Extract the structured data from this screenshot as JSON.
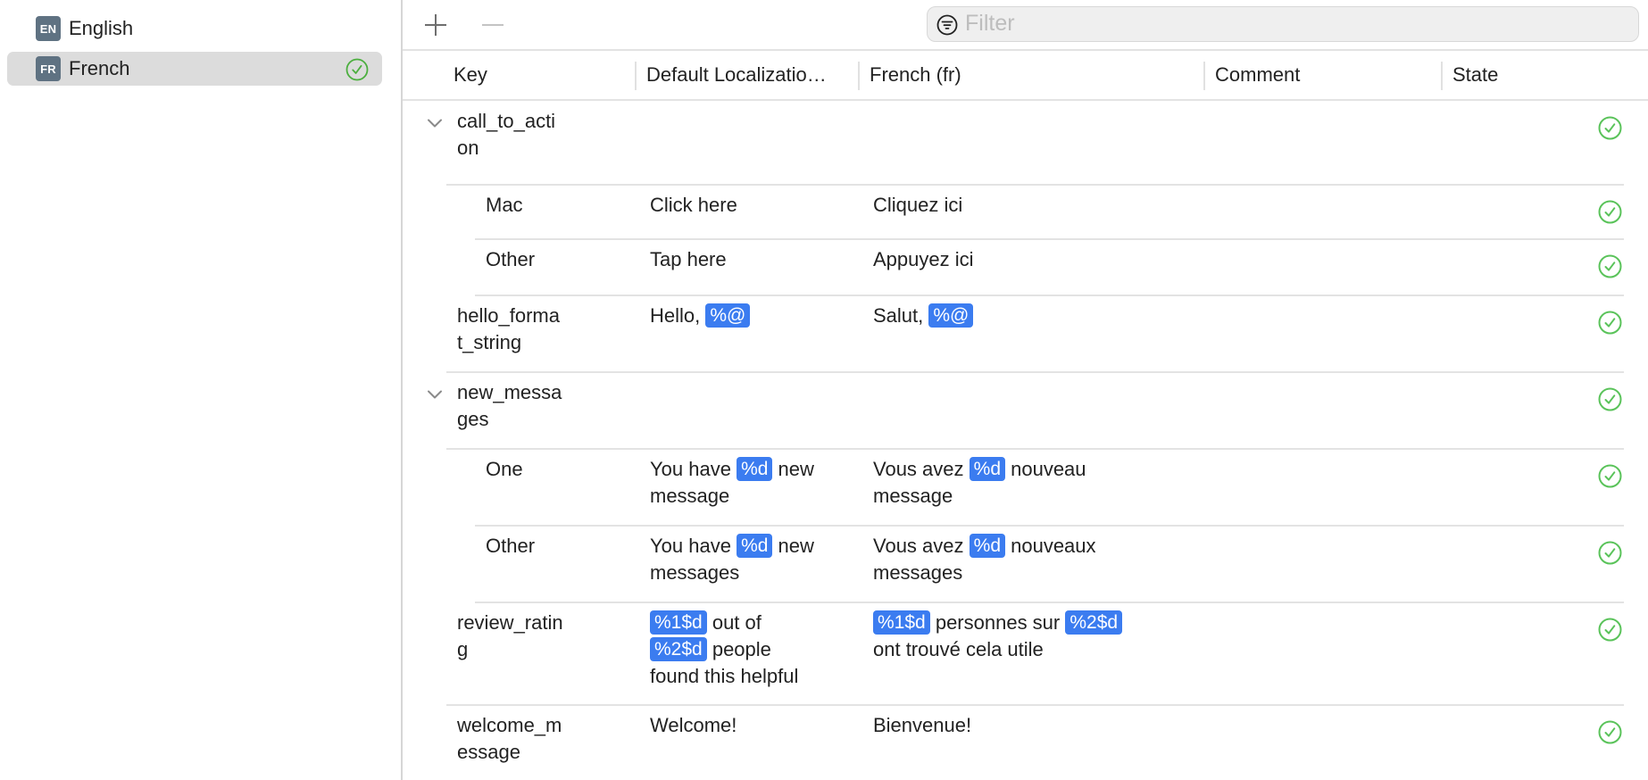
{
  "sidebar": {
    "languages": [
      {
        "code": "EN",
        "label": "English",
        "selected": false,
        "complete": false
      },
      {
        "code": "FR",
        "label": "French",
        "selected": true,
        "complete": true
      }
    ]
  },
  "toolbar": {
    "add_icon": "plus-icon",
    "remove_icon": "minus-icon",
    "filter_placeholder": "Filter",
    "filter_value": "",
    "filter_icon": "filter-circle-icon"
  },
  "columns": [
    "Key",
    "Default Localizatio…",
    "French (fr)",
    "Comment",
    "State"
  ],
  "rows": [
    {
      "key": [
        "call_to_acti",
        "on"
      ],
      "level": 0,
      "expandable": true,
      "expanded": true,
      "default": [],
      "french": [],
      "comment": "",
      "state": "translated"
    },
    {
      "key": [
        "Mac"
      ],
      "level": 1,
      "default": [
        [
          {
            "t": "Click here"
          }
        ]
      ],
      "french": [
        [
          {
            "t": "Cliquez ici"
          }
        ]
      ],
      "comment": "",
      "state": "translated"
    },
    {
      "key": [
        "Other"
      ],
      "level": 1,
      "default": [
        [
          {
            "t": "Tap here"
          }
        ]
      ],
      "french": [
        [
          {
            "t": "Appuyez ici"
          }
        ]
      ],
      "comment": "",
      "state": "translated"
    },
    {
      "key": [
        "hello_forma",
        "t_string"
      ],
      "level": 0,
      "default": [
        [
          {
            "t": "Hello, "
          },
          {
            "tok": "%@"
          }
        ]
      ],
      "french": [
        [
          {
            "t": "Salut, "
          },
          {
            "tok": "%@"
          }
        ]
      ],
      "comment": "",
      "state": "translated"
    },
    {
      "key": [
        "new_messa",
        "ges"
      ],
      "level": 0,
      "expandable": true,
      "expanded": true,
      "default": [],
      "french": [],
      "comment": "",
      "state": "translated"
    },
    {
      "key": [
        "One"
      ],
      "level": 1,
      "default": [
        [
          {
            "t": "You have "
          },
          {
            "tok": "%d"
          },
          {
            "t": " new"
          }
        ],
        [
          {
            "t": "message"
          }
        ]
      ],
      "french": [
        [
          {
            "t": "Vous avez "
          },
          {
            "tok": "%d"
          },
          {
            "t": " nouveau"
          }
        ],
        [
          {
            "t": "message"
          }
        ]
      ],
      "comment": "",
      "state": "translated"
    },
    {
      "key": [
        "Other"
      ],
      "level": 1,
      "default": [
        [
          {
            "t": "You have "
          },
          {
            "tok": "%d"
          },
          {
            "t": " new"
          }
        ],
        [
          {
            "t": "messages"
          }
        ]
      ],
      "french": [
        [
          {
            "t": "Vous avez "
          },
          {
            "tok": "%d"
          },
          {
            "t": " nouveaux"
          }
        ],
        [
          {
            "t": "messages"
          }
        ]
      ],
      "comment": "",
      "state": "translated"
    },
    {
      "key": [
        "review_ratin",
        "g"
      ],
      "level": 0,
      "default": [
        [
          {
            "tok": "%1$d"
          },
          {
            "t": " out of"
          }
        ],
        [
          {
            "tok": "%2$d"
          },
          {
            "t": " people"
          }
        ],
        [
          {
            "t": "found this helpful"
          }
        ]
      ],
      "french": [
        [
          {
            "tok": "%1$d"
          },
          {
            "t": " personnes sur "
          },
          {
            "tok": "%2$d"
          }
        ],
        [
          {
            "t": "ont trouvé cela utile"
          }
        ]
      ],
      "comment": "",
      "state": "translated"
    },
    {
      "key": [
        "welcome_m",
        "essage"
      ],
      "level": 0,
      "default": [
        [
          {
            "t": "Welcome!"
          }
        ]
      ],
      "french": [
        [
          {
            "t": "Bienvenue!"
          }
        ]
      ],
      "comment": "",
      "state": "translated"
    }
  ],
  "colors": {
    "accent_token": "#3b7cf0",
    "state_ok": "#5ac35a",
    "sidebar_check": "#4caf3f"
  }
}
